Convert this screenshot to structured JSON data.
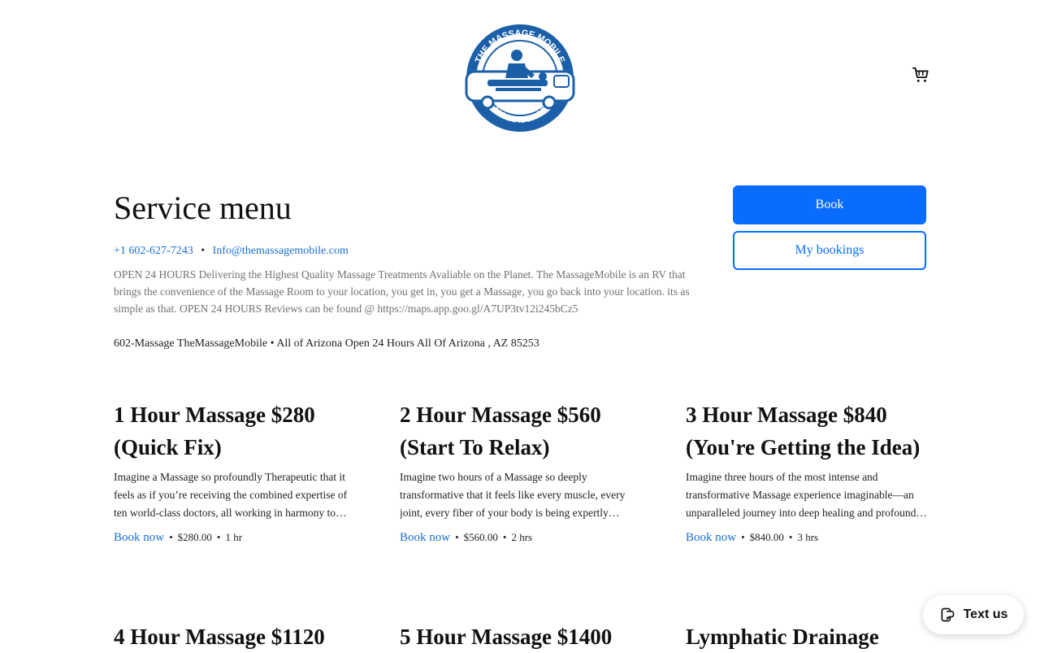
{
  "header": {
    "logo_text_top": "THE MASSAGE MOBILE",
    "logo_text_bottom": "602-MASSAGE",
    "brand_color": "#1a5fa8",
    "cart_icon": "cart-icon"
  },
  "intro": {
    "title": "Service menu",
    "phone": "+1 602-627-7243",
    "separator": "•",
    "email": "Info@themassagemobile.com",
    "description": "OPEN 24 HOURS Delivering the Highest Quality Massage Treatments Avaliable on the Planet. The MassageMobile is an RV that brings the convenience of the Massage Room to your location, you get in, you get a Massage, you go back into your location. its as simple as that. OPEN 24 HOURS Reviews can be found @ https://maps.app.goo.gl/A7UP3tv12i245bCz5",
    "address": "602-Massage TheMassageMobile • All of Arizona Open 24 Hours All Of Arizona , AZ 85253"
  },
  "actions": {
    "book_label": "Book",
    "bookings_label": "My bookings",
    "accent_color": "#0a6cff"
  },
  "services": [
    {
      "title": "1 Hour Massage $280 (Quick Fix)",
      "description": "Imagine a Massage so profoundly Therapeutic that it feels as if you’re receiving the combined expertise of ten world-class doctors, all working in harmony to restore your body.",
      "book_label": "Book now",
      "price": "$280.00",
      "duration": "1 hr"
    },
    {
      "title": "2 Hour Massage $560 (Start To Relax)",
      "description": "Imagine two hours of a Massage so deeply transformative that it feels like every muscle, every joint, every fiber of your body is being expertly restored.",
      "book_label": "Book now",
      "price": "$560.00",
      "duration": "2 hrs"
    },
    {
      "title": "3 Hour Massage $840 (You're Getting the Idea)",
      "description": "Imagine three hours of the most intense and transformative Massage experience imaginable—an unparalleled journey into deep healing and profound relaxation.",
      "book_label": "Book now",
      "price": "$840.00",
      "duration": "3 hrs"
    }
  ],
  "next_services": [
    {
      "title": "4 Hour Massage $1120"
    },
    {
      "title": "5 Hour Massage $1400"
    },
    {
      "title": "Lymphatic Drainage"
    }
  ],
  "widget": {
    "label": "Text us",
    "icon": "chat-phone-icon"
  }
}
